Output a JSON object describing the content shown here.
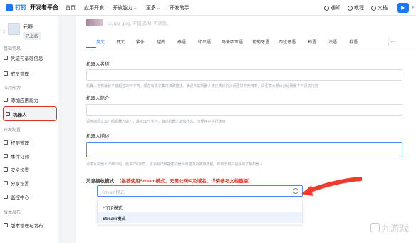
{
  "topbar": {
    "logo_text": "钉钉",
    "logo_sub": "开发者平台",
    "nav": [
      "首页",
      "应用开发",
      "开放能力",
      "更多",
      "开发助手"
    ],
    "notify_label": "通知",
    "tutorial_label": "教程",
    "docs_label": "文档"
  },
  "sidebar": {
    "app_name": "元野",
    "app_status": "已上线",
    "sections": {
      "basic": "基础信息",
      "app_ability": "应用能力",
      "dev_config": "开发配置",
      "version": "版本发布"
    },
    "items": {
      "credentials": "凭证与基础信息",
      "members": "成员管理",
      "add_ability": "添加应用能力",
      "robot": "机器人",
      "permissions": "权限管理",
      "events": "事件订阅",
      "security": "安全设置",
      "share": "分享设置",
      "monitor": "监控中心",
      "release": "版本管理与发布"
    }
  },
  "main": {
    "strip_text": "ai, jpg, jpeg, 不超过2M, 可添加。",
    "tabs": [
      "英文",
      "日文",
      "繁体",
      "越南",
      "泰语",
      "印尼语",
      "马来西亚语",
      "葡萄牙语",
      "西班牙语",
      "韩语",
      "法语",
      "俄语",
      "…"
    ],
    "fields": {
      "name_label": "机器人名称",
      "name_hint": "机器人名称最长不能超过20个字符，请在有限文案内准确描述，满足你的机器人被正确识别从而更好的使用率，请注意大部分对话场景下可见的内容",
      "intro_label": "机器人简介",
      "intro_hint": "请用简短文案介绍机器人能力，最多50个字符，简述机器人能做什么，方便用户进行使用",
      "desc_label": "机器人描述",
      "desc_hint": "请填写机器人详细介绍，最多200字符，请清晰详细描述机器人的能力及使用流程，有助于用户更好的了解机器人",
      "mode_label": "消息接收模式:",
      "mode_hint": "（推荐使用Stream模式，无需公网IP及域名，详情参考文档链接）",
      "mode_placeholder": "Stream模式",
      "options": [
        "HTTP模式",
        "Stream模式"
      ]
    }
  },
  "watermark": "九游戏"
}
